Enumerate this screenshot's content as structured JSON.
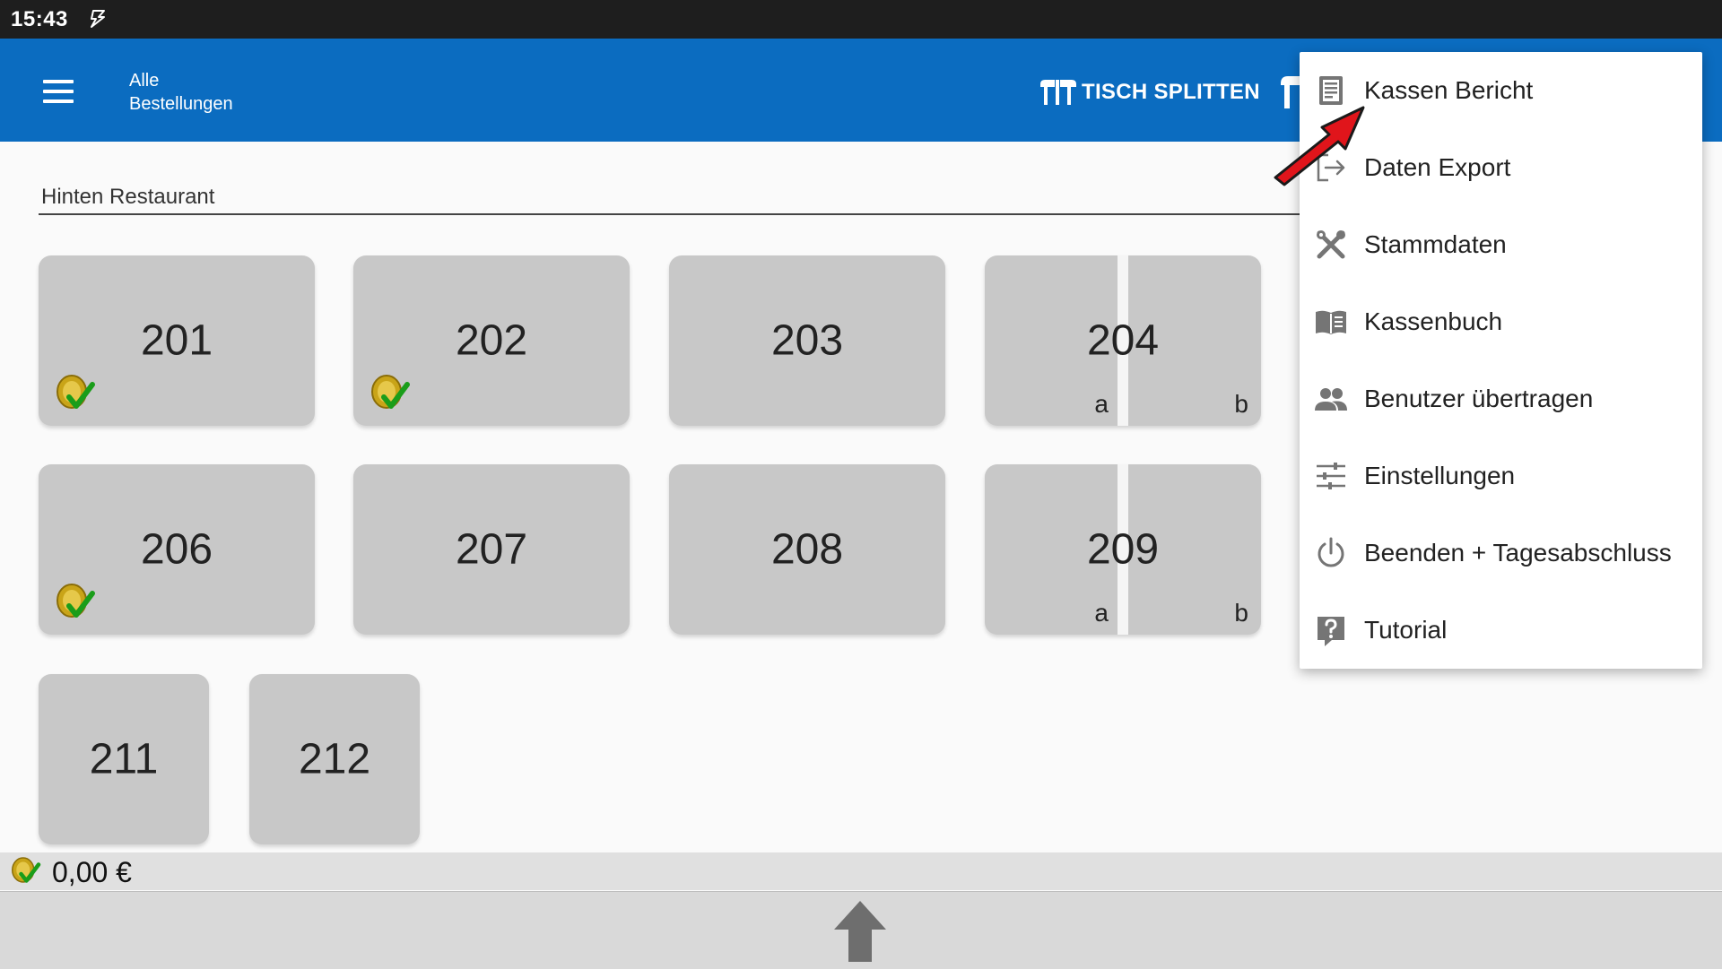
{
  "status_bar": {
    "time": "15:43"
  },
  "app_bar": {
    "title_line1": "Alle",
    "title_line2": "Bestellungen",
    "split_label": "TISCH SPLITTEN"
  },
  "section": {
    "label": "Hinten Restaurant"
  },
  "tables": [
    {
      "number": "201",
      "paid": true
    },
    {
      "number": "202",
      "paid": true
    },
    {
      "number": "203"
    },
    {
      "number": "204",
      "split": [
        "a",
        "b"
      ]
    },
    {
      "number": "206",
      "paid": true
    },
    {
      "number": "207"
    },
    {
      "number": "208"
    },
    {
      "number": "209",
      "split": [
        "a",
        "b"
      ]
    },
    {
      "number": "211"
    },
    {
      "number": "212"
    }
  ],
  "footer": {
    "total": "0,00 €"
  },
  "menu": {
    "items": [
      {
        "label": "Kassen Bericht",
        "icon": "report-icon"
      },
      {
        "label": "Daten Export",
        "icon": "export-icon"
      },
      {
        "label": "Stammdaten",
        "icon": "tools-icon"
      },
      {
        "label": "Kassenbuch",
        "icon": "book-icon"
      },
      {
        "label": "Benutzer übertragen",
        "icon": "users-icon"
      },
      {
        "label": "Einstellungen",
        "icon": "sliders-icon"
      },
      {
        "label": "Beenden + Tagesabschluss",
        "icon": "power-icon"
      },
      {
        "label": "Tutorial",
        "icon": "help-icon"
      }
    ]
  },
  "colors": {
    "primary": "#0b6cc0",
    "status_bar": "#1e1e1e",
    "tile": "#c8c8c8",
    "annotation_arrow": "#e0151b"
  }
}
